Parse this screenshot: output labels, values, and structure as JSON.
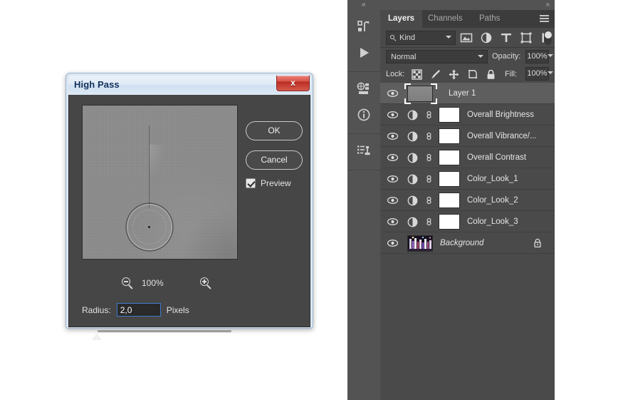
{
  "dialog": {
    "title": "High Pass",
    "close_label": "x",
    "close_icon": "window-close-icon",
    "buttons": {
      "ok": "OK",
      "cancel": "Cancel"
    },
    "preview_checkbox": {
      "label": "Preview",
      "checked": true
    },
    "zoom": {
      "level": "100%",
      "zoom_out_icon": "zoom-out-icon",
      "zoom_in_icon": "zoom-in-icon"
    },
    "radius": {
      "label": "Radius:",
      "value": "2,0",
      "unit": "Pixels",
      "placeholder": "2,0"
    },
    "preview_image_alt": "high-pass-filter-preview"
  },
  "dock": {
    "collapse_left_icon": "«",
    "collapse_right_icon": "»",
    "rail": [
      {
        "name": "history-panel-icon",
        "label": "History"
      },
      {
        "name": "actions-play-icon",
        "label": "Play"
      },
      {
        "name": "3d-panel-icon",
        "label": "3D"
      },
      {
        "name": "info-panel-icon",
        "label": "Info"
      },
      {
        "name": "clone-source-panel-icon",
        "label": "Clone Source"
      }
    ]
  },
  "panel": {
    "tabs": [
      {
        "label": "Layers",
        "active": true
      },
      {
        "label": "Channels",
        "active": false
      },
      {
        "label": "Paths",
        "active": false
      }
    ],
    "menu_icon": "panel-menu-icon",
    "filter": {
      "search_icon": "search-icon",
      "kind_value": "Kind",
      "chevron_icon": "chevron-down-icon",
      "icons": [
        "filter-pixel-layers-icon",
        "filter-adjustment-layers-icon",
        "filter-type-layers-icon",
        "filter-shape-layers-icon",
        "filter-smart-object-layers-icon"
      ],
      "toggle_icon": "filter-enable-toggle"
    },
    "blend": {
      "mode": "Normal",
      "mode_chevron_icon": "chevron-down-icon",
      "opacity_label": "Opacity:",
      "opacity_value": "100%",
      "opacity_chevron_icon": "chevron-down-icon"
    },
    "lock": {
      "label": "Lock:",
      "icons": [
        "lock-transparent-pixels-icon",
        "lock-image-pixels-icon",
        "lock-position-icon",
        "lock-artboard-nesting-icon",
        "lock-all-icon"
      ],
      "fill_label": "Fill:",
      "fill_value": "100%",
      "fill_chevron_icon": "chevron-down-icon"
    },
    "layers": [
      {
        "name": "Layer 1",
        "type": "pixel",
        "selected": true,
        "visible": true,
        "visibility_icon": "eye-icon",
        "locked": false
      },
      {
        "name": "Overall Brightness",
        "type": "adjustment",
        "selected": false,
        "visible": true,
        "visibility_icon": "eye-icon",
        "adjustment_icon": "adjustment-layer-icon",
        "link_icon": "mask-link-icon",
        "locked": false
      },
      {
        "name": "Overall Vibrance/...",
        "type": "adjustment",
        "selected": false,
        "visible": true,
        "visibility_icon": "eye-icon",
        "adjustment_icon": "adjustment-layer-icon",
        "link_icon": "mask-link-icon",
        "locked": false
      },
      {
        "name": "Overall Contrast",
        "type": "adjustment",
        "selected": false,
        "visible": true,
        "visibility_icon": "eye-icon",
        "adjustment_icon": "adjustment-layer-icon",
        "link_icon": "mask-link-icon",
        "locked": false
      },
      {
        "name": "Color_Look_1",
        "type": "adjustment",
        "selected": false,
        "visible": true,
        "visibility_icon": "eye-icon",
        "adjustment_icon": "adjustment-layer-icon",
        "link_icon": "mask-link-icon",
        "locked": false
      },
      {
        "name": "Color_Look_2",
        "type": "adjustment",
        "selected": false,
        "visible": true,
        "visibility_icon": "eye-icon",
        "adjustment_icon": "adjustment-layer-icon",
        "link_icon": "mask-link-icon",
        "locked": false
      },
      {
        "name": "Color_Look_3",
        "type": "adjustment",
        "selected": false,
        "visible": true,
        "visibility_icon": "eye-icon",
        "adjustment_icon": "adjustment-layer-icon",
        "link_icon": "mask-link-icon",
        "locked": false
      },
      {
        "name": "Background",
        "type": "background",
        "selected": false,
        "visible": true,
        "visibility_icon": "eye-icon",
        "locked": true,
        "lock_icon": "lock-icon"
      }
    ]
  },
  "colors": {
    "panel_bg": "#4a4a4a",
    "panel_dark": "#3c3c3c",
    "rail_bg": "#535353",
    "selected_row": "#5e5e5e",
    "dialog_body": "#464646",
    "dialog_chrome": "#d9e6f2",
    "focus_blue": "#3d7cc9",
    "close_red": "#bb2d24",
    "text": "#e6e6e6"
  }
}
